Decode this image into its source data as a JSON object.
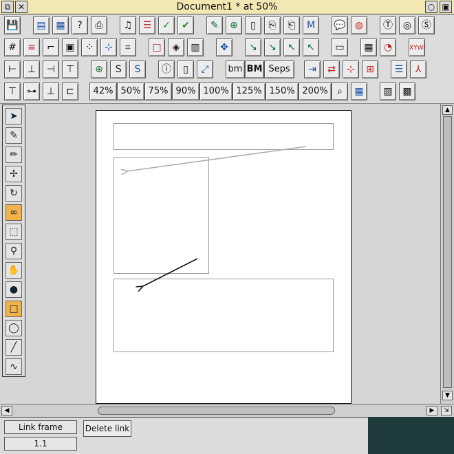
{
  "window": {
    "title": "Document1 * at 50%",
    "title_bar_color": "#f2e8b3"
  },
  "toolbar": {
    "row1_icons": [
      "save-icon",
      "save-as-icon",
      "save-selection-icon",
      "help-icon",
      "print-icon",
      "spell-options-icon",
      "style-list-icon",
      "spellcheck-icon",
      "spellcheck-check-icon",
      "edit-story-icon",
      "new-story-icon",
      "new-page-icon",
      "copy-page-icon",
      "copy-frame-icon",
      "merge-icon",
      "speech-bubble-icon",
      "color-wheel-icon",
      "text-tool-icon",
      "target-icon",
      "symbol-icon"
    ],
    "row2_icons": [
      "grid-icon",
      "guides-icon",
      "rulers-icon",
      "frame-border-icon",
      "dots-grid-icon",
      "snap-icon",
      "crop-icon",
      "frame-icon",
      "link-frames-icon",
      "layers-icon",
      "move-frame-icon",
      "bring-forward-icon",
      "send-back-icon",
      "bring-front-icon",
      "send-front-icon",
      "window-icon",
      "columns-icon",
      "gauge-icon",
      "xywh-icon"
    ],
    "row3_text": {
      "bm": "bm",
      "BM": "BM",
      "seps": "Seps"
    },
    "row3_icons": [
      "align-left-icon",
      "align-center-icon",
      "align-right-icon",
      "tree-icon",
      "url-globe-icon",
      "stamp-icon",
      "highlighter-icon",
      "info-icon",
      "clipboard-icon",
      "resize-icon",
      "export-icon",
      "flow-icon",
      "crosshair-icon",
      "tiles-icon",
      "stack-icon",
      "pdf-icon"
    ],
    "row4_icons": [
      "distribute-top-icon",
      "distribute-middle-icon",
      "distribute-bottom-icon",
      "group-icon",
      "zoom-view-icon",
      "fit-page-icon",
      "gradient-icon",
      "pattern-icon"
    ],
    "zoom_levels": [
      "42%",
      "50%",
      "75%",
      "90%",
      "100%",
      "125%",
      "150%",
      "200%"
    ]
  },
  "palette": {
    "tools": [
      "select-arrow-icon",
      "pen-icon",
      "pencil-icon",
      "node-edit-icon",
      "rotate-icon",
      "link-tool-icon",
      "marquee-icon",
      "magnify-icon",
      "hand-icon",
      "gradient-fill-icon",
      "rectangle-icon",
      "ellipse-icon",
      "line-icon",
      "curve-icon"
    ],
    "active_tool": "link-tool-icon",
    "active_color": "#f0b34a"
  },
  "status": {
    "mode_label": "Link frame",
    "page_number": "1.1",
    "delete_link_label": "Delete link"
  }
}
